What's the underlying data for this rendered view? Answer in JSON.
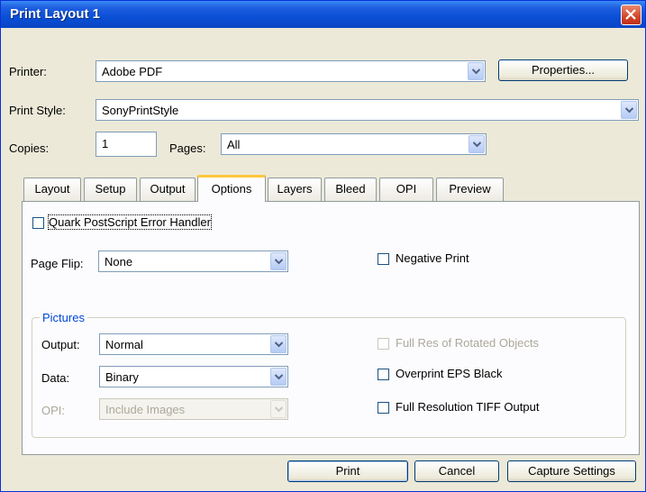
{
  "window": {
    "title": "Print Layout 1"
  },
  "printer": {
    "label": "Printer:",
    "value": "Adobe PDF",
    "properties_label": "Properties..."
  },
  "print_style": {
    "label": "Print Style:",
    "value": "SonyPrintStyle"
  },
  "copies": {
    "label": "Copies:",
    "value": "1"
  },
  "pages": {
    "label": "Pages:",
    "value": "All"
  },
  "tabs": [
    {
      "label": "Layout"
    },
    {
      "label": "Setup"
    },
    {
      "label": "Output"
    },
    {
      "label": "Options",
      "active": true
    },
    {
      "label": "Layers"
    },
    {
      "label": "Bleed"
    },
    {
      "label": "OPI"
    },
    {
      "label": "Preview"
    }
  ],
  "options": {
    "error_handler_label": "Quark PostScript Error Handler",
    "error_handler_checked": false,
    "page_flip": {
      "label": "Page Flip:",
      "value": "None"
    },
    "negative_print": {
      "label": "Negative Print",
      "checked": false
    }
  },
  "pictures": {
    "group_label": "Pictures",
    "output": {
      "label": "Output:",
      "value": "Normal"
    },
    "data": {
      "label": "Data:",
      "value": "Binary"
    },
    "opi": {
      "label": "OPI:",
      "value": "Include Images",
      "disabled": true
    },
    "full_res_rotated": {
      "label": "Full Res of Rotated Objects",
      "checked": false,
      "disabled": true
    },
    "overprint_eps_black": {
      "label": "Overprint EPS Black",
      "checked": false
    },
    "full_res_tiff": {
      "label": "Full Resolution TIFF Output",
      "checked": false
    }
  },
  "buttons": {
    "print": "Print",
    "cancel": "Cancel",
    "capture": "Capture Settings"
  },
  "colors": {
    "titlebar": "#0a4fd6",
    "dialog_bg": "#ece9d8",
    "group_label": "#0046d5",
    "active_tab_accent": "#ffc83c"
  }
}
